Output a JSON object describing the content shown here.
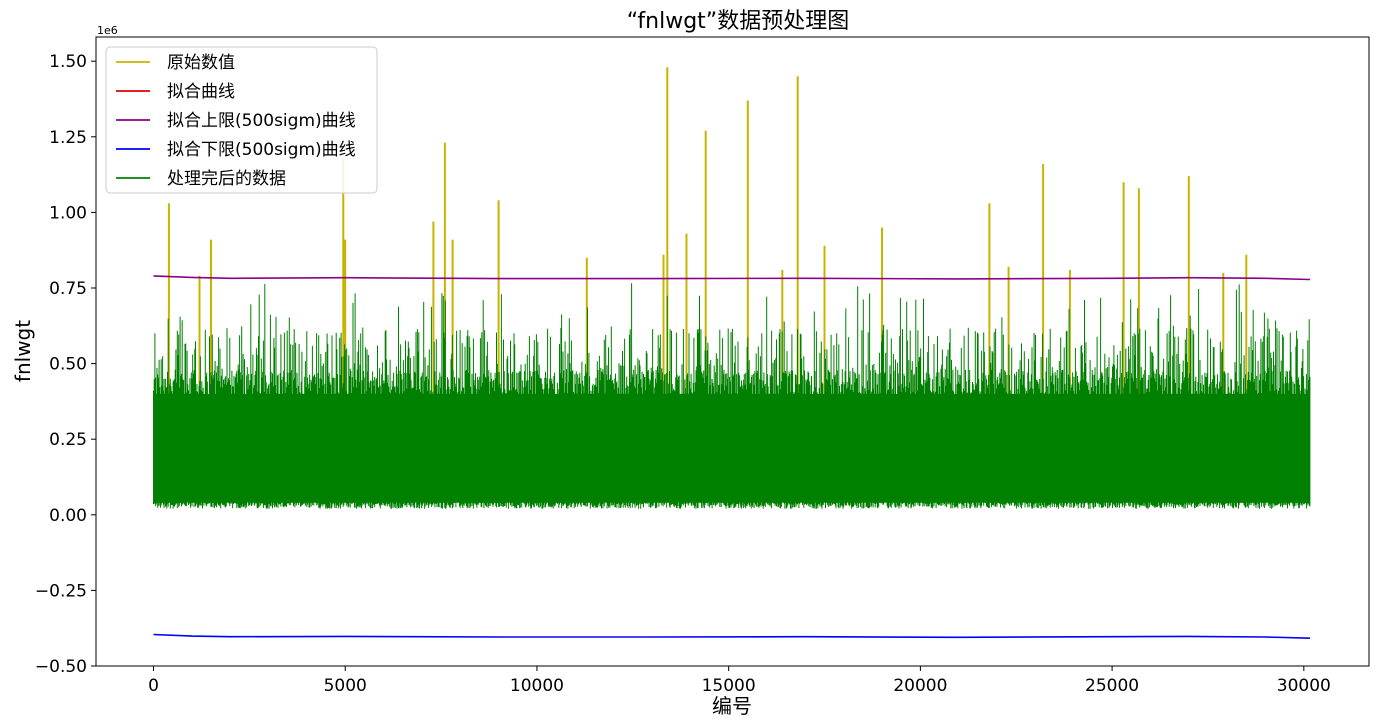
{
  "chart_data": {
    "type": "line",
    "title": "“fnlwgt”数据预处理图",
    "xlabel": "编号",
    "ylabel": "fnlwgt",
    "y_offset_label": "1e6",
    "xlim": [
      -1500,
      31700
    ],
    "ylim": [
      -0.5,
      1.58
    ],
    "x_ticks": [
      0,
      5000,
      10000,
      15000,
      20000,
      25000,
      30000
    ],
    "x_tick_labels": [
      "0",
      "5000",
      "10000",
      "15000",
      "20000",
      "25000",
      "30000"
    ],
    "y_ticks": [
      -0.5,
      -0.25,
      0,
      0.25,
      0.5,
      0.75,
      1.0,
      1.25,
      1.5
    ],
    "y_tick_labels": [
      "−0.50",
      "−0.25",
      "0.00",
      "0.25",
      "0.50",
      "0.75",
      "1.00",
      "1.25",
      "1.50"
    ],
    "grid": false,
    "legend_position": "top-left",
    "series": [
      {
        "name": "原始数值",
        "color": "#c8b400",
        "x_range": [
          0,
          30161
        ],
        "band_low": 0.02,
        "band_high": 0.5,
        "spikes": [
          [
            400,
            1.03
          ],
          [
            1200,
            0.79
          ],
          [
            1500,
            0.91
          ],
          [
            4950,
            1.18
          ],
          [
            5000,
            0.91
          ],
          [
            7300,
            0.97
          ],
          [
            7600,
            1.23
          ],
          [
            7800,
            0.91
          ],
          [
            9000,
            1.04
          ],
          [
            11300,
            0.85
          ],
          [
            13300,
            0.86
          ],
          [
            13400,
            1.48
          ],
          [
            13900,
            0.93
          ],
          [
            14400,
            1.27
          ],
          [
            15500,
            1.37
          ],
          [
            16400,
            0.81
          ],
          [
            16800,
            1.45
          ],
          [
            17500,
            0.89
          ],
          [
            19000,
            0.95
          ],
          [
            21800,
            1.03
          ],
          [
            22300,
            0.82
          ],
          [
            23200,
            1.16
          ],
          [
            23900,
            0.81
          ],
          [
            25300,
            1.1
          ],
          [
            25700,
            1.08
          ],
          [
            27000,
            1.12
          ],
          [
            27900,
            0.8
          ],
          [
            28500,
            0.86
          ]
        ]
      },
      {
        "name": "拟合曲线",
        "color": "#e00000",
        "x": [
          0,
          30161
        ],
        "y": [
          0.19,
          0.19
        ]
      },
      {
        "name": "拟合上限(500sigm)曲线",
        "color": "#8b008b",
        "x": [
          0,
          1000,
          2000,
          5000,
          9000,
          13000,
          17000,
          21000,
          25000,
          27000,
          29000,
          30161
        ],
        "y": [
          0.79,
          0.785,
          0.782,
          0.784,
          0.781,
          0.781,
          0.782,
          0.78,
          0.782,
          0.784,
          0.782,
          0.778
        ]
      },
      {
        "name": "拟合下限(500sigm)曲线",
        "color": "#0000ff",
        "x": [
          0,
          1000,
          2000,
          5000,
          9000,
          13000,
          17000,
          21000,
          25000,
          27000,
          29000,
          30161
        ],
        "y": [
          -0.396,
          -0.401,
          -0.403,
          -0.402,
          -0.404,
          -0.404,
          -0.403,
          -0.405,
          -0.403,
          -0.402,
          -0.404,
          -0.408
        ]
      },
      {
        "name": "处理完后的数据",
        "color": "#008000",
        "x_range": [
          0,
          30161
        ],
        "band_low": 0.02,
        "band_high": 0.5,
        "max": 0.77
      }
    ]
  }
}
